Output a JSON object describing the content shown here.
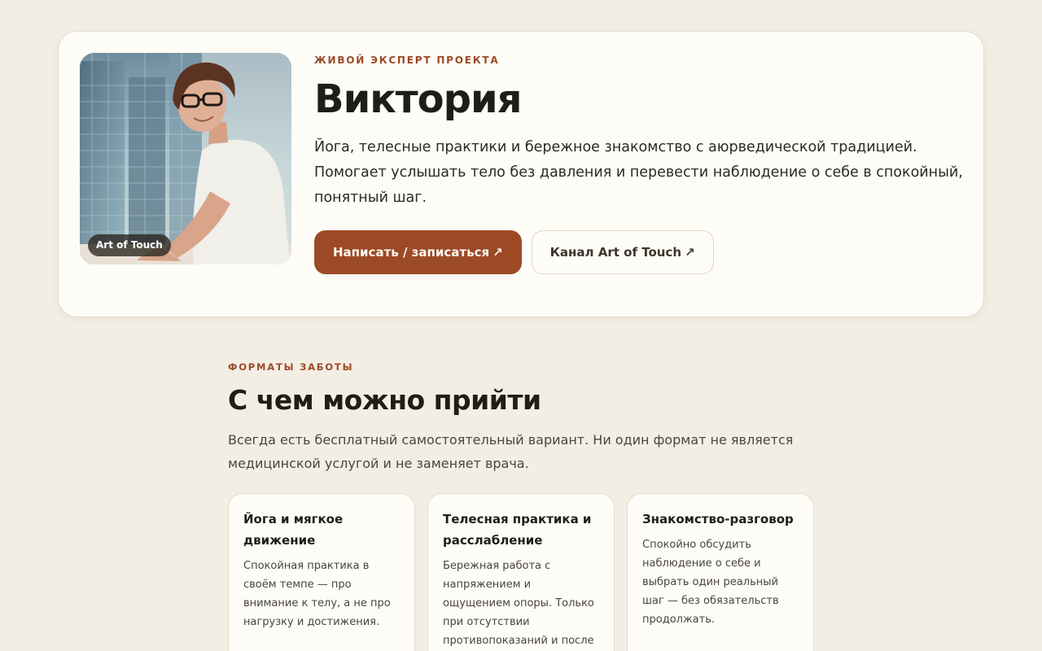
{
  "expert": {
    "photo_badge": "Art of Touch",
    "eyebrow": "ЖИВОЙ ЭКСПЕРТ ПРОЕКТА",
    "name": "Виктория",
    "description": "Йога, телесные практики и бережное знакомство с аюрведической традицией. Помогает услышать тело без давления и перевести наблюдение о себе в спокойный, понятный шаг.",
    "primary_button": "Написать / записаться",
    "secondary_button": "Канал Art of Touch",
    "button_icon": "↗"
  },
  "formats": {
    "eyebrow": "ФОРМАТЫ ЗАБОТЫ",
    "title": "С чем можно прийти",
    "intro": "Всегда есть бесплатный самостоятельный вариант. Ни один формат не является медицинской услугой и не заменяет врача.",
    "cards": [
      {
        "title": "Йога и мягкое движение",
        "text": "Спокойная практика в своём темпе — про внимание к телу, а не про нагрузку и достижения."
      },
      {
        "title": "Телесная практика и расслабление",
        "text": "Бережная работа с напряжением и ощущением опоры. Только при отсутствии противопоказаний и после"
      },
      {
        "title": "Знакомство-разговор",
        "text": "Спокойно обсудить наблюдение о себе и выбрать один реальный шаг — без обязательств продолжать."
      }
    ]
  },
  "colors": {
    "background": "#f3eee4",
    "card": "#fdfcf7",
    "accent": "#9c4a26"
  }
}
